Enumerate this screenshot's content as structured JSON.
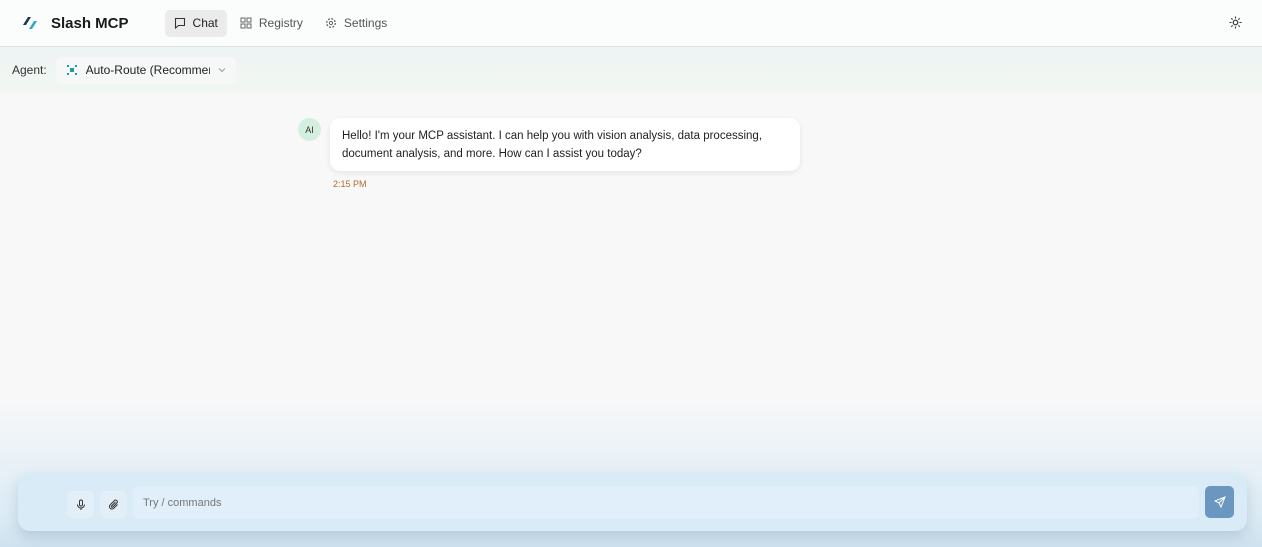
{
  "header": {
    "brand": "Slash MCP",
    "tabs": [
      {
        "label": "Chat"
      },
      {
        "label": "Registry"
      },
      {
        "label": "Settings"
      }
    ]
  },
  "agent": {
    "label": "Agent:",
    "selected": "Auto-Route (Recommended)"
  },
  "messages": [
    {
      "avatar": "AI",
      "text": "Hello! I'm your MCP assistant. I can help you with vision analysis, data processing, document analysis, and more. How can I assist you today?",
      "time": "2:15 PM"
    }
  ],
  "composer": {
    "placeholder": "Try / commands"
  }
}
